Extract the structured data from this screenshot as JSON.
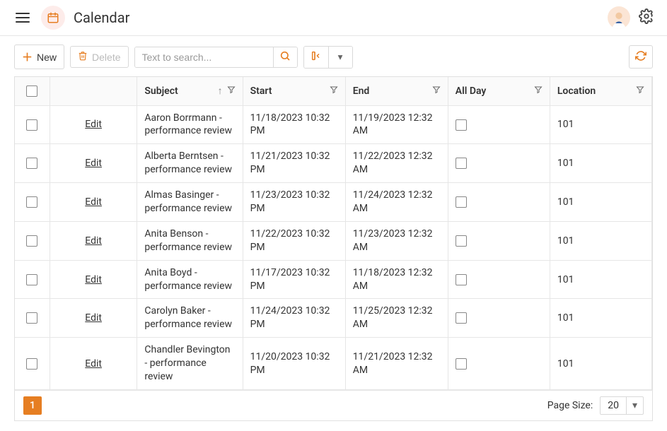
{
  "header": {
    "title": "Calendar"
  },
  "toolbar": {
    "new_label": "New",
    "delete_label": "Delete",
    "search_placeholder": "Text to search..."
  },
  "columns": {
    "subject": "Subject",
    "start": "Start",
    "end": "End",
    "all_day": "All Day",
    "location": "Location",
    "edit": "Edit"
  },
  "rows": [
    {
      "subject": "Aaron Borrmann - performance review",
      "start": "11/18/2023 10:32 PM",
      "end": "11/19/2023 12:32 AM",
      "all_day": false,
      "location": "101"
    },
    {
      "subject": "Alberta Berntsen - performance review",
      "start": "11/21/2023 10:32 PM",
      "end": "11/22/2023 12:32 AM",
      "all_day": false,
      "location": "101"
    },
    {
      "subject": "Almas Basinger - performance review",
      "start": "11/23/2023 10:32 PM",
      "end": "11/24/2023 12:32 AM",
      "all_day": false,
      "location": "101"
    },
    {
      "subject": "Anita Benson - performance review",
      "start": "11/22/2023 10:32 PM",
      "end": "11/23/2023 12:32 AM",
      "all_day": false,
      "location": "101"
    },
    {
      "subject": "Anita Boyd - performance review",
      "start": "11/17/2023 10:32 PM",
      "end": "11/18/2023 12:32 AM",
      "all_day": false,
      "location": "101"
    },
    {
      "subject": "Carolyn Baker - performance review",
      "start": "11/24/2023 10:32 PM",
      "end": "11/25/2023 12:32 AM",
      "all_day": false,
      "location": "101"
    },
    {
      "subject": "Chandler Bevington - performance review",
      "start": "11/20/2023 10:32 PM",
      "end": "11/21/2023 12:32 AM",
      "all_day": false,
      "location": "101"
    }
  ],
  "pagination": {
    "current_page": "1",
    "page_size_label": "Page Size:",
    "page_size_value": "20"
  }
}
